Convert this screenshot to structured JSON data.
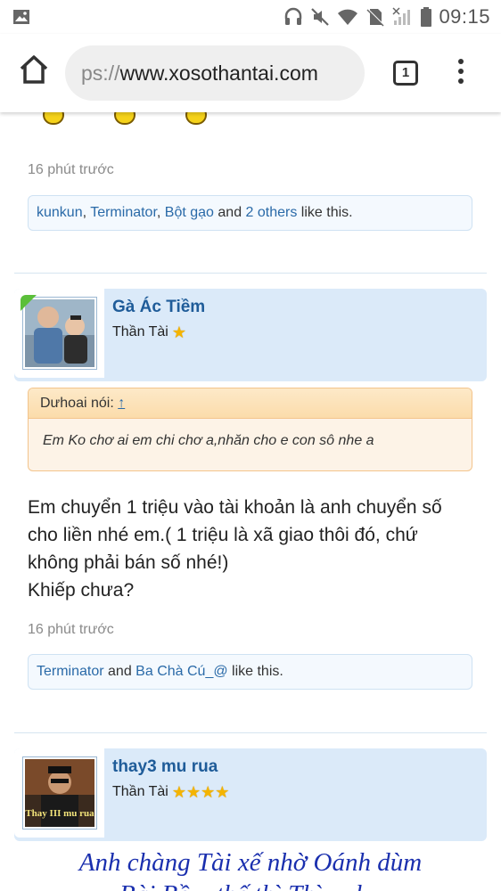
{
  "status_bar": {
    "time": "09:15"
  },
  "browser": {
    "url_prefix": "ps://",
    "url_host": "www.xosothantai.com",
    "tab_count": "1"
  },
  "post1": {
    "timestamp": "16 phút trước",
    "likes": {
      "users": [
        "kunkun",
        "Terminator",
        "Bột gạo"
      ],
      "sep1": ", ",
      "sep2": ", ",
      "and": " and ",
      "others": "2 others",
      "tail": " like this."
    }
  },
  "post2": {
    "user": {
      "name": "Gà Ác Tiềm",
      "title": "Thần Tài",
      "stars": "★"
    },
    "quote": {
      "author": "Dưhoai nói:",
      "arrow": "↑",
      "text": "Em Ko chơ ai em chi chơ a,nhăn cho e con sô nhe a"
    },
    "message": [
      "Em chuyển 1 triệu vào tài khoản là anh chuyển số",
      "cho liền nhé em.( 1 triệu là xã giao thôi đó, chứ",
      "không phải bán số nhé!)",
      "Khiếp chưa?"
    ],
    "timestamp": "16 phút trước",
    "likes": {
      "user1": "Terminator",
      "and": " and ",
      "user2": "Ba Chà Cú_@",
      "tail": " like this."
    }
  },
  "post3": {
    "user": {
      "name": "thay3 mu rua",
      "title": "Thần Tài",
      "stars": "★★★★",
      "avatar_caption": "Thay III mu rua"
    },
    "headline": "Anh chàng Tài xế nhờ Oánh dùm",
    "headline2": "Bài Bồ... thế thì Thì ... l..."
  }
}
